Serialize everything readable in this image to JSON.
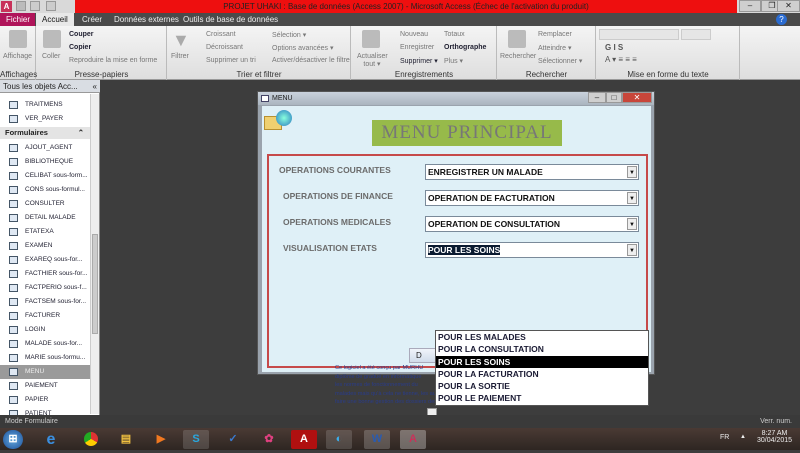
{
  "window": {
    "title": "PROJET UHAKI : Base de données (Access 2007) - Microsoft Access (Échec de l'activation du produit)"
  },
  "tabs": [
    "Fichier",
    "Accueil",
    "Créer",
    "Données externes",
    "Outils de base de données"
  ],
  "ribbon": {
    "affichages": {
      "label": "Affichages",
      "button": "Affichage"
    },
    "presse": {
      "label": "Presse-papiers",
      "coller": "Coller",
      "couper": "Couper",
      "copier": "Copier",
      "reproduire": "Reproduire la mise en forme"
    },
    "trier": {
      "label": "Trier et filtrer",
      "filtrer": "Filtrer",
      "croissant": "Croissant",
      "decroissant": "Décroissant",
      "supprimer_tri": "Supprimer un tri",
      "selection": "Sélection ▾",
      "options": "Options avancées ▾",
      "activer": "Activer/désactiver le filtre"
    },
    "enreg": {
      "label": "Enregistrements",
      "actualiser": "Actualiser tout ▾",
      "nouveau": "Nouveau",
      "enregistrer": "Enregistrer",
      "supprimer": "Supprimer ▾",
      "totaux": "Totaux",
      "orthographe": "Orthographe",
      "plus": "Plus ▾"
    },
    "rechercher": {
      "label": "Rechercher",
      "rechercher": "Rechercher",
      "remplacer": "Remplacer",
      "atteindre": "Atteindre ▾",
      "selectionner": "Sélectionner ▾"
    },
    "texte": {
      "label": "Mise en forme du texte"
    }
  },
  "nav": {
    "header": "Tous les objets Acc...",
    "top_items": [
      "TRAITMENS",
      "VER_PAYER"
    ],
    "section": "Formulaires",
    "items": [
      "AJOUT_AGENT",
      "BIBLIOTHEQUE",
      "CELIBAT sous-form...",
      "CONS sous-formul...",
      "CONSULTER",
      "DETAIL MALADE",
      "ETATEXA",
      "EXAMEN",
      "EXAREQ sous-for...",
      "FACTHIER sous-for...",
      "FACTPERIO sous-f...",
      "FACTSEM sous-for...",
      "FACTURER",
      "LOGIN",
      "MALADE sous-for...",
      "MARIE sous-formu...",
      "MENU",
      "PAIEMENT",
      "PAPIER",
      "PATIENT"
    ],
    "selected": "MENU"
  },
  "form": {
    "title": "MENU",
    "banner": "MENU PRINCIPAL",
    "rows": [
      {
        "label": "OPERATIONS COURANTES",
        "value": "ENREGISTRER UN MALADE"
      },
      {
        "label": "OPERATIONS DE FINANCE",
        "value": "OPERATION DE FACTURATION"
      },
      {
        "label": "OPERATIONS MEDICALES",
        "value": "OPERATION DE CONSULTATION"
      },
      {
        "label": "VISUALISATION ETATS",
        "value": "POUR LES SOINS"
      }
    ],
    "dropdown": [
      "POUR LES MALADES",
      "POUR LA CONSULTATION",
      "POUR LES SOINS",
      "POUR LA FACTURATION",
      "POUR LA SORTIE",
      "POUR LE PAIEMENT"
    ],
    "dropdown_selected": "POUR LES SOINS",
    "button": "D",
    "description": [
      "Ce logiciel a été conçu par MURHU",
      "diplôme de gradué en informatique",
      "les normes de fonctionnement du",
      "malades mais qu'à cela ne tienne, les autres centres de santés peuvent l'utiliser afin de",
      "faire une bonne gestion des dossiers des malades"
    ]
  },
  "status": {
    "left": "Mode Formulaire",
    "right": "Verr. num."
  },
  "taskbar": {
    "lang": "FR",
    "time": "8:27 AM",
    "date": "30/04/2015"
  }
}
